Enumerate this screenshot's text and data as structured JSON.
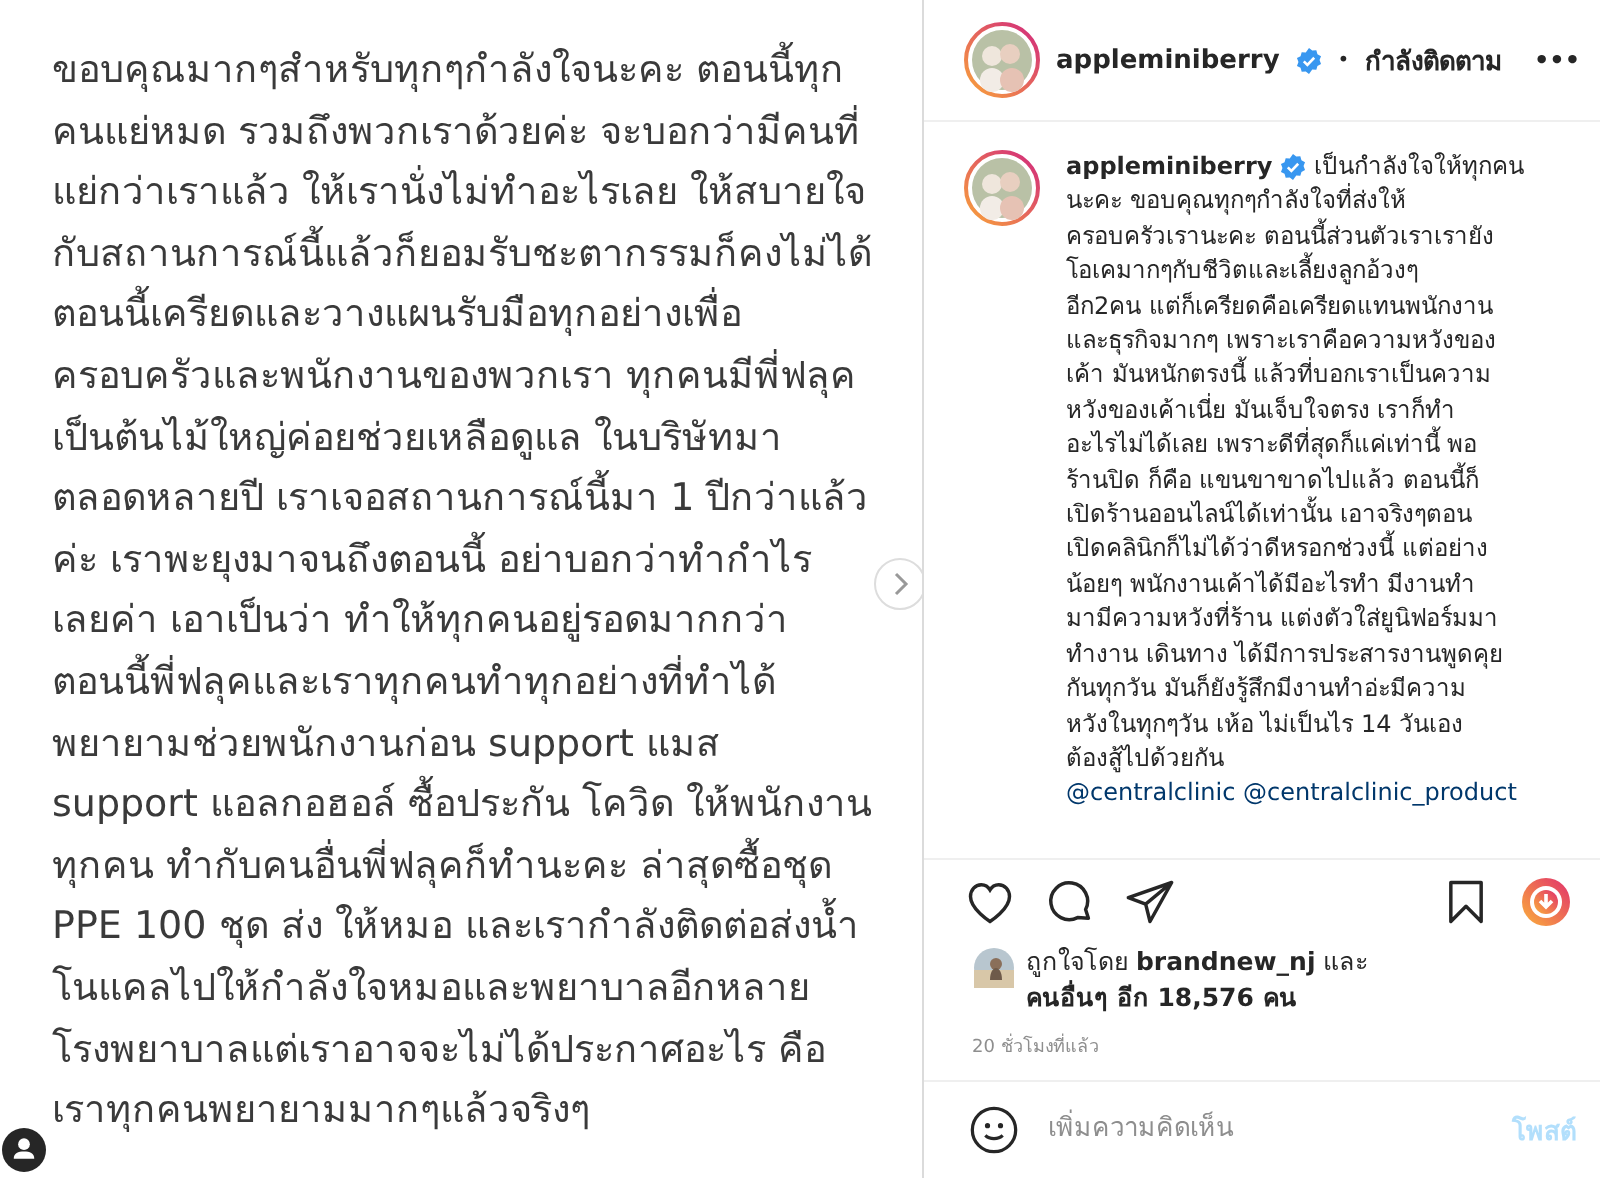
{
  "post_image": {
    "lines": [
      "ขอบคุณมากๆสำหรับทุกๆกำลังใจนะคะ ตอนนี้ทุก",
      "คนแย่หมด รวมถึงพวกเราด้วยค่ะ จะบอกว่ามีคนที่",
      "แย่กว่าเราแล้ว ให้เรานั่งไม่ทำอะไรเลย ให้สบายใจ",
      "กับสถานการณ์นี้แล้วก็ยอมรับชะตากรรมก็คงไม่ได้",
      "ตอนนี้เครียดและวางแผนรับมือทุกอย่างเพื่อ",
      "ครอบครัวและพนักงานของพวกเรา ทุกคนมีพี่ฟลุค",
      "เป็นต้นไม้ใหญ่ค่อยช่วยเหลือดูแล ในบริษัทมา",
      "ตลอดหลายปี เราเจอสถานการณ์นี้มา 1 ปีกว่าแล้ว",
      "ค่ะ เราพะยุงมาจนถึงตอนนี้ อย่าบอกว่าทำกำไร",
      "เลยค่า เอาเป็นว่า ทำให้ทุกคนอยู่รอดมากกว่า",
      "ตอนนี้พี่ฟลุคและเราทุกคนทำทุกอย่างที่ทำได้",
      "พยายามช่วยพนักงานก่อน support แมส",
      "support แอลกอฮอล์ ซื้อประกัน โควิด ให้พนักงาน",
      "ทุกคน ทำกับคนอื่นพี่ฟลุคก็ทำนะคะ ล่าสุดซื้อชุด",
      "PPE 100 ชุด ส่ง ให้หมอ และเรากำลังติดต่อส่งน้ำ",
      "โนแคลไปให้กำลังใจหมอและพยาบาลอีกหลาย",
      "โรงพยาบาลแต่เราอาจจะไม่ได้ประกาศอะไร คือ",
      "เราทุกคนพยายามมากๆแล้วจริงๆ"
    ]
  },
  "header": {
    "username": "appleminiberry",
    "verified": true,
    "separator": "•",
    "follow_status": "กำลังติดตาม",
    "more": "•••"
  },
  "caption": {
    "username": "appleminiberry",
    "verified": true,
    "lines": [
      "เป็นกำลังใจให้ทุกคน",
      "นะคะ ขอบคุณทุกๆกำลังใจที่ส่งให้",
      "ครอบครัวเรานะคะ ตอนนี้ส่วนตัวเราเรายัง",
      "โอเคมากๆกับชีวิตและเลี้ยงลูกอ้วงๆ",
      "อีก2คน แต่ก็เครียดคือเครียดแทนพนักงาน",
      "และธุรกิจมากๆ เพราะเราคือความหวังของ",
      "เค้า มันหนักตรงนี้ แล้วที่บอกเราเป็นความ",
      "หวังของเค้าเนี่ย มันเจ็บใจตรง เราก็ทำ",
      "อะไรไม่ได้เลย เพราะดีที่สุดก็แค่เท่านี้ พอ",
      "ร้านปิด ก็คือ แขนขาขาดไปแล้ว ตอนนี้ก็",
      "เปิดร้านออนไลน์ได้เท่านั้น เอาจริงๆตอน",
      "เปิดคลินิกก็ไม่ได้ว่าดีหรอกช่วงนี้ แต่อย่าง",
      "น้อยๆ พนักงานเค้าได้มีอะไรทำ มีงานทำ",
      "มามีความหวังที่ร้าน แต่งตัวใส่ยูนิฟอร์มมา",
      "ทำงาน เดินทาง ได้มีการประสารงานพูดคุย",
      "กันทุกวัน มันก็ยังรู้สึกมีงานทำอ่ะมีความ",
      "หวังในทุกๆวัน เห้อ ไม่เป็นไร 14 วันเอง",
      "ต้องสู้ไปด้วยกัน"
    ],
    "mentions": "@centralclinic @centralclinic_product"
  },
  "actions": {
    "liked": false,
    "saved": false
  },
  "likes": {
    "liked_by": "ถูกใจโดย **brandnew_nj** และ",
    "count": "คนอื่นๆ อีก 18,576 คน"
  },
  "time": "20 ชั่วโมงที่แล้ว",
  "comment": {
    "placeholder": "เพิ่มความคิดเห็น",
    "post_button": "โพสต์",
    "disabled": true
  }
}
